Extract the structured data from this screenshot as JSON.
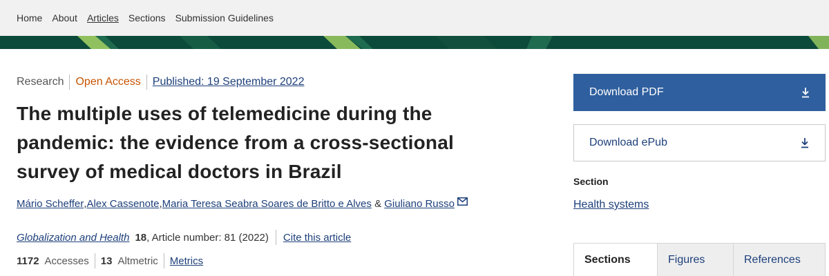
{
  "nav": {
    "items": [
      {
        "label": "Home",
        "active": false
      },
      {
        "label": "About",
        "active": false
      },
      {
        "label": "Articles",
        "active": true
      },
      {
        "label": "Sections",
        "active": false
      },
      {
        "label": "Submission Guidelines",
        "active": false
      }
    ]
  },
  "colors": {
    "nav_bg": "#f1f1f1",
    "banner_dark": "#0c4a3a",
    "banner_light": "#9fce63",
    "open_access": "#c65301",
    "link": "#1d3f7a",
    "pdf_button": "#2f5f9e"
  },
  "article": {
    "type": "Research",
    "access": "Open Access",
    "published": "Published: 19 September 2022",
    "title": "The multiple uses of telemedicine during the pandemic: the evidence from a cross-sectional survey of medical doctors in Brazil",
    "authors": [
      "Mário Scheffer",
      "Alex Cassenote",
      "Maria Teresa Seabra Soares de Britto e Alves",
      "Giuliano Russo"
    ],
    "author_separator": ", ",
    "author_conjunction": "&",
    "journal": "Globalization and Health",
    "volume": "18",
    "article_number": ", Article number: 81 (2022)",
    "cite_label": "Cite this article",
    "accesses_count": "1172",
    "accesses_label": "Accesses",
    "altmetric_count": "13",
    "altmetric_label": "Altmetric",
    "metrics_label": "Metrics"
  },
  "sidebar": {
    "download_pdf": "Download PDF",
    "download_epub": "Download ePub",
    "section_heading": "Section",
    "section_link": "Health systems",
    "tabs": [
      {
        "label": "Sections",
        "active": true
      },
      {
        "label": "Figures",
        "active": false
      },
      {
        "label": "References",
        "active": false
      }
    ]
  },
  "icons": {
    "download": "download-arrow-icon",
    "mail": "envelope-icon"
  }
}
